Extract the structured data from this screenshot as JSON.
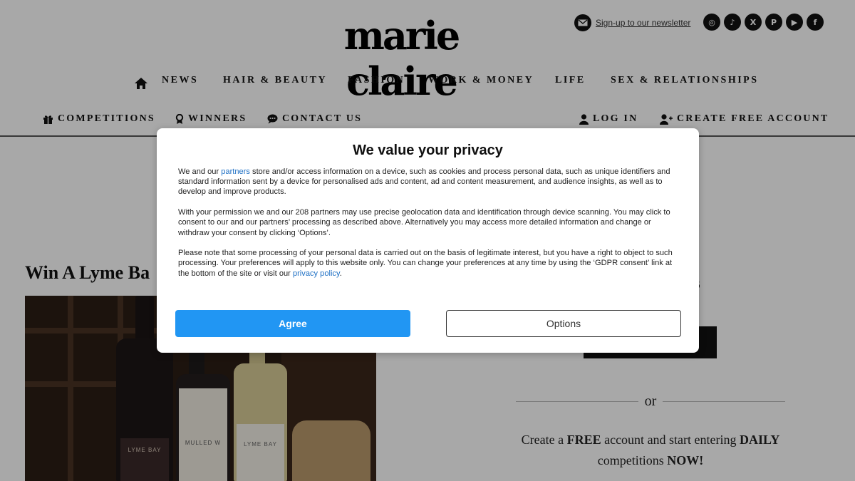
{
  "header": {
    "logo": "marie claire",
    "newsletter_label": "Sign-up to our newsletter",
    "socials": [
      {
        "icon": "instagram-icon",
        "glyph": "◎"
      },
      {
        "icon": "tiktok-icon",
        "glyph": "♪"
      },
      {
        "icon": "x-icon",
        "glyph": "X"
      },
      {
        "icon": "pinterest-icon",
        "glyph": "P"
      },
      {
        "icon": "youtube-icon",
        "glyph": "▶"
      },
      {
        "icon": "facebook-icon",
        "glyph": "f"
      }
    ]
  },
  "nav": {
    "items": [
      "NEWS",
      "HAIR & BEAUTY",
      "FASHION",
      "WORK & MONEY",
      "LIFE",
      "SEX & RELATIONSHIPS"
    ]
  },
  "subnav": {
    "competitions": "COMPETITIONS",
    "winners": "WINNERS",
    "contact": "CONTACT US",
    "login": "LOG IN",
    "create_account": "CREATE FREE ACCOUNT"
  },
  "article": {
    "title": "Win A Lyme Ba",
    "bottle_labels": [
      "LYME BAY",
      "MULLED W",
      "LYME BAY"
    ]
  },
  "sidebar": {
    "heading_fragment": "ers",
    "or": "or",
    "create_prefix": "Create a ",
    "create_free": "FREE",
    "create_middle": " account and start entering ",
    "create_daily": "DAILY",
    "create_line2": "competitions ",
    "create_now": "NOW!"
  },
  "consent": {
    "title": "We value your privacy",
    "p1_before": "We and our ",
    "p1_link": "partners",
    "p1_after": " store and/or access information on a device, such as cookies and process personal data, such as unique identifiers and standard information sent by a device for personalised ads and content, ad and content measurement, and audience insights, as well as to develop and improve products.",
    "p2": "With your permission we and our 208 partners may use precise geolocation data and identification through device scanning. You may click to consent to our and our partners’ processing as described above. Alternatively you may access more detailed information and change or withdraw your consent by clicking ‘Options’.",
    "p3_before": "Please note that some processing of your personal data is carried out on the basis of legitimate interest, but you have a right to object to such processing. Your preferences will apply to this website only. You can change your preferences at any time by using the ‘GDPR consent’ link at the bottom of the site or visit our ",
    "p3_link": "privacy policy",
    "p3_after": ".",
    "agree_label": "Agree",
    "options_label": "Options",
    "agree_color": "#2196f3",
    "link_color": "#1d6fc4"
  }
}
